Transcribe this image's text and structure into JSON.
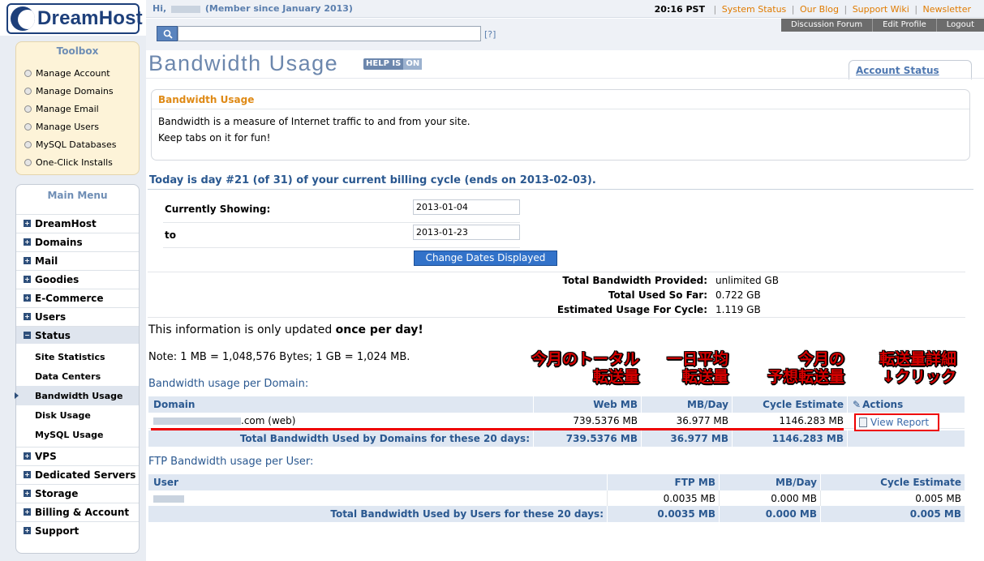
{
  "header": {
    "greeting_prefix": "Hi,",
    "greeting_suffix": "(Member since January 2013)",
    "time": "20:16 PST",
    "links": [
      "System Status",
      "Our Blog",
      "Support Wiki",
      "Newsletter"
    ],
    "tabs": [
      "Discussion Forum",
      "Edit Profile",
      "Logout"
    ],
    "search": {
      "value": "",
      "help": "[?]"
    },
    "logo_text": "DreamHost"
  },
  "toolbox": {
    "title": "Toolbox",
    "items": [
      "Manage Account",
      "Manage Domains",
      "Manage Email",
      "Manage Users",
      "MySQL Databases",
      "One-Click Installs"
    ]
  },
  "mainmenu": {
    "title": "Main Menu",
    "items": [
      "DreamHost",
      "Domains",
      "Mail",
      "Goodies",
      "E-Commerce",
      "Users",
      "Status"
    ],
    "status_subitems": [
      "Site Statistics",
      "Data Centers",
      "Bandwidth Usage",
      "Disk Usage",
      "MySQL Usage"
    ],
    "items_after": [
      "VPS",
      "Dedicated Servers",
      "Storage",
      "Billing & Account",
      "Support"
    ]
  },
  "page": {
    "title": "Bandwidth Usage",
    "help_badge": [
      "HELP IS",
      "ON"
    ],
    "account_status": "Account Status",
    "info_box": {
      "heading": "Bandwidth Usage",
      "lines": [
        "Bandwidth is a measure of Internet traffic to and from your site.",
        "Keep tabs on it for fun!"
      ]
    },
    "cycle_text": "Today is day #21 (of 31) of your current billing cycle (ends on 2013-02-03).",
    "form": {
      "showing_label": "Currently Showing:",
      "to_label": "to",
      "from_date": "2013-01-04",
      "to_date": "2013-01-23",
      "button": "Change Dates Displayed"
    },
    "totals": [
      {
        "label": "Total Bandwidth Provided:",
        "value": "unlimited GB"
      },
      {
        "label": "Total Used So Far:",
        "value": "0.722 GB"
      },
      {
        "label": "Estimated Usage For Cycle:",
        "value": "1.119 GB"
      }
    ],
    "update_note_prefix": "This information is only updated ",
    "update_note_bold": "once per day!",
    "mb_note": "Note: 1 MB = 1,048,576 Bytes; 1 GB = 1,024 MB.",
    "domain_heading": "Bandwidth usage per Domain:",
    "domain_table": {
      "headers": [
        "Domain",
        "Web MB",
        "MB/Day",
        "Cycle Estimate",
        "Actions"
      ],
      "row": {
        "domain_suffix": ".com (web)",
        "web_mb": "739.5376 MB",
        "mb_day": "36.977 MB",
        "cycle": "1146.283 MB",
        "action": "View Report"
      },
      "total": {
        "label": "Total Bandwidth Used by Domains for these 20 days:",
        "web_mb": "739.5376 MB",
        "mb_day": "36.977 MB",
        "cycle": "1146.283 MB"
      }
    },
    "ftp_heading": "FTP Bandwidth usage per User:",
    "ftp_table": {
      "headers": [
        "User",
        "FTP MB",
        "MB/Day",
        "Cycle Estimate"
      ],
      "row": {
        "ftp_mb": "0.0035 MB",
        "mb_day": "0.000 MB",
        "cycle": "0.005 MB"
      },
      "total": {
        "label": "Total Bandwidth Used by Users for these 20 days:",
        "ftp_mb": "0.0035 MB",
        "mb_day": "0.000 MB",
        "cycle": "0.005 MB"
      }
    },
    "annotations": {
      "total": [
        "今月のトータル",
        "転送量"
      ],
      "daily": [
        "一日平均",
        "転送量"
      ],
      "estimate": [
        "今月の",
        "予想転送量"
      ],
      "detail": [
        "転送量詳細",
        "↓クリック"
      ]
    }
  },
  "colors": {
    "accent": "#2a5890",
    "title": "#6c87ad",
    "highlight": "#df8a16",
    "annotation": "#d40000"
  }
}
